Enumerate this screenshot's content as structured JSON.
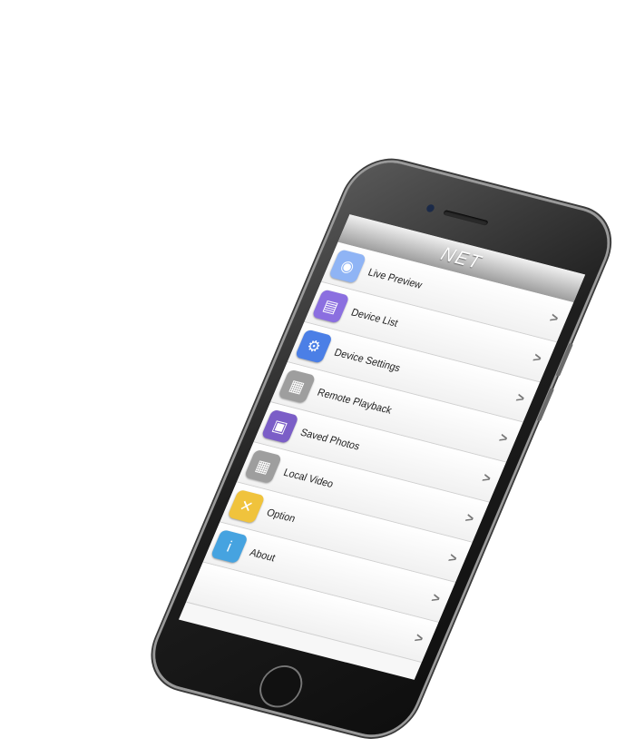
{
  "app": {
    "title": "NET"
  },
  "menu": [
    {
      "label": "Live Preview",
      "icon": "camera-icon",
      "color": "#8fb4f5"
    },
    {
      "label": "Device List",
      "icon": "device-list-icon",
      "color": "#8b6fe0"
    },
    {
      "label": "Device Settings",
      "icon": "device-settings-icon",
      "color": "#4b7fe6"
    },
    {
      "label": "Remote Playback",
      "icon": "film-reel-icon",
      "color": "#9e9e9e"
    },
    {
      "label": "Saved Photos",
      "icon": "photo-icon",
      "color": "#7b5ec7"
    },
    {
      "label": "Local Video",
      "icon": "film-icon",
      "color": "#9e9e9e"
    },
    {
      "label": "Option",
      "icon": "tools-icon",
      "color": "#f0c33c"
    },
    {
      "label": "About",
      "icon": "info-icon",
      "color": "#46a3e0"
    },
    {
      "label": ""
    }
  ],
  "chevron": ">"
}
